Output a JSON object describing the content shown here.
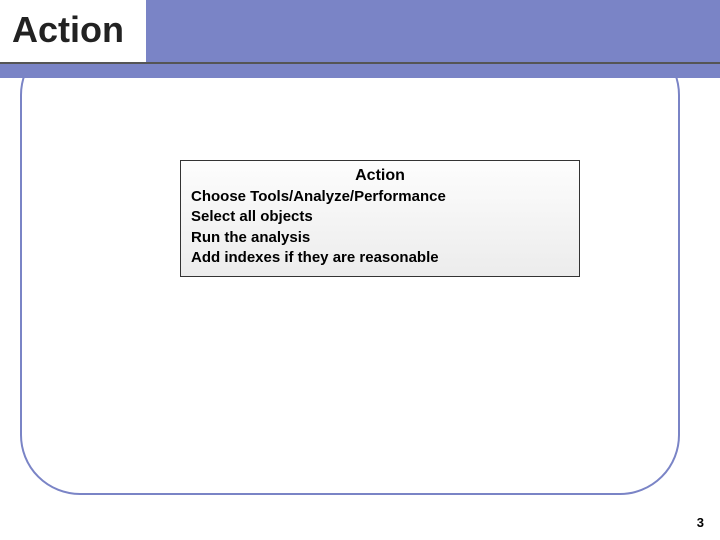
{
  "slide": {
    "title": "Action",
    "card": {
      "heading": "Action",
      "lines": [
        "Choose Tools/Analyze/Performance",
        "Select all objects",
        "Run the analysis",
        "Add indexes if they are reasonable"
      ]
    },
    "page_number": "3"
  }
}
